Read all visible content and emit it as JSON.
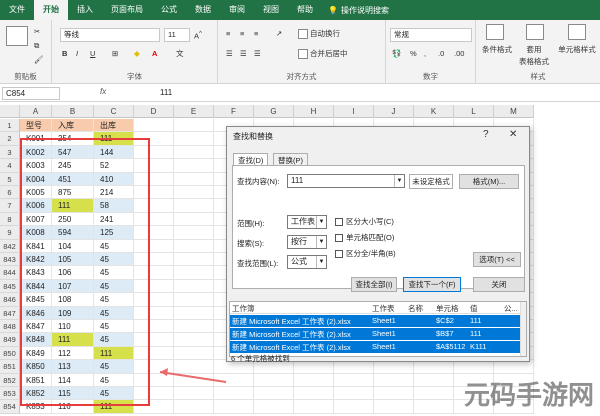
{
  "ribbon_tabs": [
    "文件",
    "开始",
    "插入",
    "页面布局",
    "公式",
    "数据",
    "审阅",
    "视图",
    "帮助"
  ],
  "active_tab": "开始",
  "tell_me": "操作说明搜索",
  "ribbon": {
    "clipboard_label": "剪贴板",
    "font_label": "字体",
    "font_name": "等线",
    "font_size": "11",
    "align_label": "对齐方式",
    "wrap_text": "自动换行",
    "merge_center": "合并后居中",
    "number_label": "数字",
    "number_format": "常规",
    "styles_label": "样式",
    "cond_format": "条件格式",
    "table_format": "套用\n表格格式",
    "cell_style": "单元格样式"
  },
  "formula_bar": {
    "cell_ref": "C854",
    "fx": "fx",
    "value": "111"
  },
  "columns": [
    "A",
    "B",
    "C",
    "D",
    "E",
    "F",
    "G",
    "H",
    "I",
    "J",
    "K",
    "L",
    "M"
  ],
  "sheet": {
    "headers": [
      "型号",
      "入库",
      "出库"
    ],
    "rows": [
      {
        "n": "2",
        "a": "K001",
        "b": "254",
        "c": "111"
      },
      {
        "n": "3",
        "a": "K002",
        "b": "547",
        "c": "144"
      },
      {
        "n": "4",
        "a": "K003",
        "b": "245",
        "c": "52"
      },
      {
        "n": "5",
        "a": "K004",
        "b": "451",
        "c": "410"
      },
      {
        "n": "6",
        "a": "K005",
        "b": "875",
        "c": "214"
      },
      {
        "n": "7",
        "a": "K006",
        "b": "111",
        "c": "58"
      },
      {
        "n": "8",
        "a": "K007",
        "b": "250",
        "c": "241"
      },
      {
        "n": "9",
        "a": "K008",
        "b": "594",
        "c": "125"
      },
      {
        "n": "842",
        "a": "K841",
        "b": "104",
        "c": "45"
      },
      {
        "n": "843",
        "a": "K842",
        "b": "105",
        "c": "45"
      },
      {
        "n": "844",
        "a": "K843",
        "b": "106",
        "c": "45"
      },
      {
        "n": "845",
        "a": "K844",
        "b": "107",
        "c": "45"
      },
      {
        "n": "846",
        "a": "K845",
        "b": "108",
        "c": "45"
      },
      {
        "n": "847",
        "a": "K846",
        "b": "109",
        "c": "45"
      },
      {
        "n": "848",
        "a": "K847",
        "b": "110",
        "c": "45"
      },
      {
        "n": "849",
        "a": "K848",
        "b": "111",
        "c": "45"
      },
      {
        "n": "850",
        "a": "K849",
        "b": "112",
        "c": "111"
      },
      {
        "n": "851",
        "a": "K850",
        "b": "113",
        "c": "45"
      },
      {
        "n": "852",
        "a": "K851",
        "b": "114",
        "c": "45"
      },
      {
        "n": "853",
        "a": "K852",
        "b": "115",
        "c": "45"
      },
      {
        "n": "854",
        "a": "K853",
        "b": "116",
        "c": "111"
      }
    ],
    "header_row_num": "1"
  },
  "dialog": {
    "title": "查找和替换",
    "help": "?",
    "close": "✕",
    "tab_find": "查找(D)",
    "tab_replace": "替换(P)",
    "find_label": "查找内容(N):",
    "find_value": "111",
    "no_format": "未设定格式",
    "format_btn": "格式(M)...",
    "scope_label": "范围(H):",
    "scope_value": "工作表",
    "search_label": "搜索(S):",
    "search_value": "按行",
    "lookin_label": "查找范围(L):",
    "lookin_value": "公式",
    "match_case": "区分大小写(C)",
    "match_cell": "单元格匹配(O)",
    "match_width": "区分全/半角(B)",
    "options_btn": "选项(T) <<",
    "find_all": "查找全部(I)",
    "find_next": "查找下一个(F)",
    "close_btn": "关闭",
    "results_header": [
      "工作簿",
      "工作表",
      "名称",
      "单元格",
      "值",
      "公..."
    ],
    "results": [
      {
        "book": "新建 Microsoft Excel 工作表 (2).xlsx",
        "sheet": "Sheet1",
        "name": "",
        "cell": "$C$2",
        "value": "111"
      },
      {
        "book": "新建 Microsoft Excel 工作表 (2).xlsx",
        "sheet": "Sheet1",
        "name": "",
        "cell": "$B$7",
        "value": "111"
      },
      {
        "book": "新建 Microsoft Excel 工作表 (2).xlsx",
        "sheet": "Sheet1",
        "name": "",
        "cell": "$A$5112",
        "value": "K111"
      }
    ],
    "status": "6 个单元格被找到"
  },
  "watermark": "元码手游网"
}
